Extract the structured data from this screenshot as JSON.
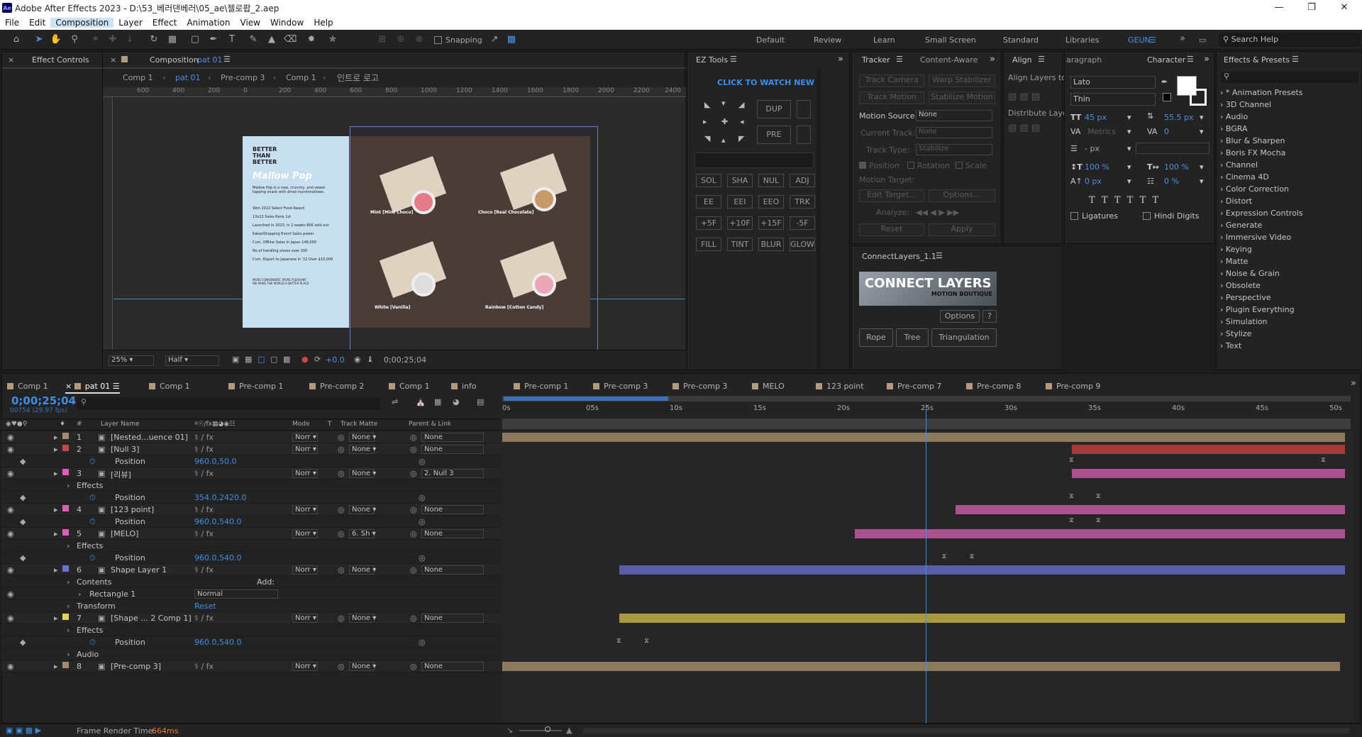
{
  "window": {
    "title": "Adobe After Effects 2023 - D:\\53_베러댄베러\\05_ae\\젤로팝_2.aep",
    "logo": "Ae"
  },
  "menu": [
    "File",
    "Edit",
    "Composition",
    "Layer",
    "Effect",
    "Animation",
    "View",
    "Window",
    "Help"
  ],
  "toolbar": {
    "snapping": "Snapping"
  },
  "workspaces": [
    "Default",
    "Review",
    "Learn",
    "Small Screen",
    "Standard",
    "Libraries",
    "GEUN"
  ],
  "search_help": "Search Help",
  "effect_controls": {
    "tab": "Effect Controls"
  },
  "composition": {
    "tab_prefix": "Composition",
    "tab_name": "pat 01",
    "breadcrumbs": [
      "Comp 1",
      "pat 01",
      "Pre-comp 3",
      "Comp 1",
      "인트로 로고"
    ],
    "ruler": [
      "600",
      "400",
      "200",
      "0",
      "200",
      "400",
      "600",
      "800",
      "1000",
      "1200",
      "1400",
      "1600",
      "1800",
      "2000",
      "2200",
      "2400"
    ],
    "zoom": "25%",
    "resolution": "Half",
    "exposure": "+0.0",
    "timecode": "0;00;25;04",
    "preview": {
      "brand": "BETTER\nTHAN\nBETTER",
      "product": "Mallow Pop",
      "desc": "Mallow Pop is a new, crunchy, and sweet topping snack with dried marshmallows.",
      "bullets": [
        "Won 2022 Select Food Award",
        "13x13 Sales Rank 1st",
        "Launched in 2023, in 2 weeks 80K sold out",
        "KakaoShopping Event Sales power",
        "Cum. Offline Sales in Japan 148,000",
        "No of handling stores over 200",
        "Cum. Export to Japanese in '22 Over $10,000"
      ],
      "footer": "MORE CONVENIENT, MORE PLEASANT\nWE MAKE THE WORLD A BETTER PLACE",
      "flavors": [
        "Mint [Mint Choco]",
        "Choco [Real Chocolate]",
        "White [Vanilla]",
        "Rainbow [Cotton Candy]"
      ]
    }
  },
  "ez_tools": {
    "tab": "EZ Tools",
    "watch": "CLICK TO WATCH NEW",
    "buttons_top": [
      "DUP",
      "PRE"
    ],
    "buttons": [
      [
        "SOL",
        "SHA",
        "NUL",
        "ADJ"
      ],
      [
        "EE",
        "EEI",
        "EEO",
        "TRK"
      ],
      [
        "+5F",
        "+10F",
        "+15F",
        "-5F"
      ],
      [
        "FILL",
        "TINT",
        "BLUR",
        "GLOW"
      ]
    ]
  },
  "tracker": {
    "tabs": [
      "Tracker",
      "Content-Aware"
    ],
    "buttons": [
      "Track Camera",
      "Warp Stabilizer",
      "Track Motion",
      "Stabilize Motion"
    ],
    "motion_source_label": "Motion Source:",
    "motion_source": "None",
    "current_track_label": "Current Track:",
    "current_track": "None",
    "track_type_label": "Track Type:",
    "track_type": "Stabilize",
    "checks": [
      "Position",
      "Rotation",
      "Scale"
    ],
    "motion_target": "Motion Target:",
    "edit_target": "Edit Target...",
    "options": "Options...",
    "analyze": "Analyze:",
    "reset": "Reset",
    "apply": "Apply"
  },
  "align": {
    "tab": "Align",
    "align_to": "Align Layers to:",
    "distribute": "Distribute Layer"
  },
  "character": {
    "tabs": [
      "aragraph",
      "Character"
    ],
    "font": "Lato",
    "style": "Thin",
    "size": "45 px",
    "leading": "55.5 px",
    "kerning": "Metrics",
    "tracking": "0",
    "stroke": "- px",
    "vscale": "100 %",
    "hscale": "100 %",
    "baseline": "0 px",
    "tsume": "0 %",
    "ligatures": "Ligatures",
    "hindi": "Hindi Digits"
  },
  "connect_layers": {
    "tab": "ConnectLayers_1.1",
    "title": "CONNECT LAYERS",
    "subtitle": "MOTION BOUTIQUE",
    "options": "Options",
    "help": "?",
    "buttons": [
      "Rope",
      "Tree",
      "Triangulation"
    ]
  },
  "effects_presets": {
    "tab": "Effects & Presets",
    "items": [
      "* Animation Presets",
      "3D Channel",
      "Audio",
      "BGRA",
      "Blur & Sharpen",
      "Boris FX Mocha",
      "Channel",
      "Cinema 4D",
      "Color Correction",
      "Distort",
      "Expression Controls",
      "Generate",
      "Immersive Video",
      "Keying",
      "Matte",
      "Noise & Grain",
      "Obsolete",
      "Perspective",
      "Plugin Everything",
      "Simulation",
      "Stylize",
      "Text"
    ]
  },
  "timeline": {
    "tabs": [
      {
        "name": "Comp 1",
        "color": "#b39a7a"
      },
      {
        "name": "pat 01",
        "color": "#b39a7a",
        "active": true
      },
      {
        "name": "Comp 1",
        "color": "#b39a7a"
      },
      {
        "name": "Pre-comp 1",
        "color": "#b39a7a"
      },
      {
        "name": "Pre-comp 2",
        "color": "#b39a7a"
      },
      {
        "name": "Comp 1",
        "color": "#b39a7a"
      },
      {
        "name": "info",
        "color": "#b39a7a"
      },
      {
        "name": "Pre-comp 1",
        "color": "#b39a7a"
      },
      {
        "name": "Pre-comp 3",
        "color": "#b39a7a"
      },
      {
        "name": "Pre-comp 3",
        "color": "#b39a7a"
      },
      {
        "name": "MELO",
        "color": "#b39a7a"
      },
      {
        "name": "123 point",
        "color": "#b39a7a"
      },
      {
        "name": "Pre-comp 7",
        "color": "#b39a7a"
      },
      {
        "name": "Pre-comp 8",
        "color": "#b39a7a"
      },
      {
        "name": "Pre-comp 9",
        "color": "#b39a7a"
      }
    ],
    "timecode": "0;00;25;04",
    "frame_info": "00754 (29.97 fps)",
    "headers": {
      "layer_name": "Layer Name",
      "mode": "Mode",
      "t": "T",
      "track_matte": "Track Matte",
      "parent": "Parent & Link",
      "num": "#"
    },
    "ruler": [
      "0s",
      "05s",
      "10s",
      "15s",
      "20s",
      "25s",
      "30s",
      "35s",
      "40s",
      "45s",
      "50s"
    ],
    "rows": [
      {
        "type": "layer",
        "num": "1",
        "name": "[Nested...uence 01]",
        "color": "#a58a6a",
        "mode": "Norr",
        "matte": "None",
        "parent": "None",
        "bar": {
          "start": 0,
          "end": 1,
          "color": "#8c7a5e"
        }
      },
      {
        "type": "layer",
        "num": "2",
        "name": "[Null 3]",
        "color": "#c64747",
        "mode": "Norr",
        "matte": "None",
        "parent": "None",
        "bar": {
          "start": 0.676,
          "end": 1,
          "color": "#a63a3a"
        }
      },
      {
        "type": "prop",
        "name": "Position",
        "value": "960.0,50.0",
        "kfs": [
          0.676,
          0.975
        ]
      },
      {
        "type": "layer",
        "num": "3",
        "name": "[리뷰]",
        "color": "#e05cb8",
        "mode": "Norr",
        "matte": "None",
        "parent": "2. Null 3",
        "bar": {
          "start": 0.676,
          "end": 1,
          "color": "#a9528f"
        }
      },
      {
        "type": "group",
        "name": "Effects"
      },
      {
        "type": "prop",
        "name": "Position",
        "value": "354.0,2420.0",
        "kfs": [
          0.676,
          0.708
        ]
      },
      {
        "type": "layer",
        "num": "4",
        "name": "[123 point]",
        "color": "#e05cb8",
        "mode": "Norr",
        "matte": "None",
        "parent": "None",
        "bar": {
          "start": 0.538,
          "end": 1,
          "color": "#a9528f"
        }
      },
      {
        "type": "prop",
        "name": "Position",
        "value": "960.0,540.0",
        "kfs": [
          0.676,
          0.708
        ]
      },
      {
        "type": "layer",
        "num": "5",
        "name": "[MELO]",
        "color": "#e05cb8",
        "mode": "Norr",
        "matte": "6. Sh",
        "parent": "None",
        "bar": {
          "start": 0.418,
          "end": 1,
          "color": "#a9528f"
        }
      },
      {
        "type": "group",
        "name": "Effects"
      },
      {
        "type": "prop",
        "name": "Position",
        "value": "960.0,540.0",
        "kfs": [
          0.525,
          0.558
        ]
      },
      {
        "type": "layer",
        "num": "6",
        "name": "Shape Layer 1",
        "color": "#6b74d6",
        "mode": "Norr",
        "matte": "None",
        "parent": "None",
        "bar": {
          "start": 0.139,
          "end": 1,
          "color": "#5a5ea8"
        }
      },
      {
        "type": "group",
        "name": "Contents",
        "extra": "Add:"
      },
      {
        "type": "sub",
        "name": "Rectangle 1",
        "value": "Normal"
      },
      {
        "type": "group",
        "name": "Transform",
        "value": "Reset"
      },
      {
        "type": "layer",
        "num": "7",
        "name": "[Shape ... 2 Comp 1]",
        "color": "#e6d25a",
        "mode": "Norr",
        "matte": "None",
        "parent": "None",
        "bar": {
          "start": 0.139,
          "end": 1,
          "color": "#a8993e"
        }
      },
      {
        "type": "group",
        "name": "Effects"
      },
      {
        "type": "prop",
        "name": "Position",
        "value": "960.0,540.0",
        "kfs": [
          0.139,
          0.172
        ]
      },
      {
        "type": "group",
        "name": "Audio"
      },
      {
        "type": "layer",
        "num": "8",
        "name": "[Pre-comp 3]",
        "color": "#a58a6a",
        "mode": "Norr",
        "matte": "None",
        "parent": "None",
        "bar": {
          "start": 0,
          "end": 0.994,
          "color": "#8c7a5e"
        }
      }
    ],
    "playhead": 0.5027,
    "render_time_label": "Frame Render Time:",
    "render_time": "664ms"
  }
}
